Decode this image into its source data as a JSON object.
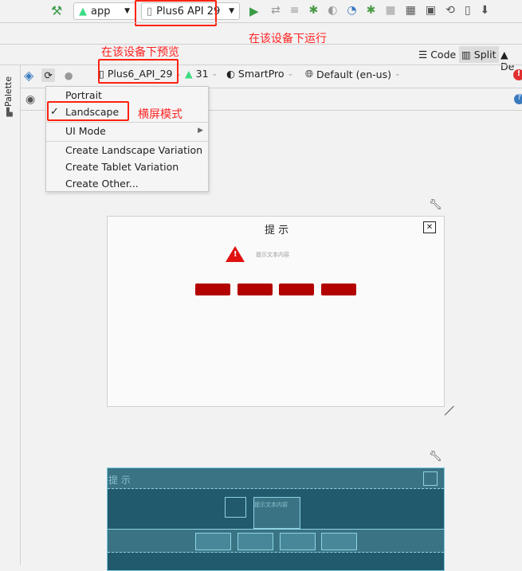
{
  "top_toolbar": {
    "module": "app",
    "device": "Plus6 API 29"
  },
  "annotations": {
    "run_note": "在该设备下运行",
    "preview_note": "在该设备下预览",
    "landscape_note": "横屏模式"
  },
  "view_modes": {
    "code": "Code",
    "split": "Split",
    "design": "De"
  },
  "design_toolbar": {
    "device": "Plus6_API_29",
    "api": "31",
    "theme": "SmartPro",
    "locale": "Default (en-us)"
  },
  "palette_label": "Palette",
  "orientation_menu": {
    "items": [
      "Portrait",
      "Landscape",
      "UI Mode",
      "Create Landscape Variation",
      "Create Tablet Variation",
      "Create Other..."
    ],
    "checked": "Landscape"
  },
  "dialog": {
    "title": "提 示",
    "close": "✕",
    "message": "提示文本内容",
    "button_color": "#b30000"
  },
  "blueprint": {
    "title": "提 示",
    "message": "提示文本内容"
  }
}
